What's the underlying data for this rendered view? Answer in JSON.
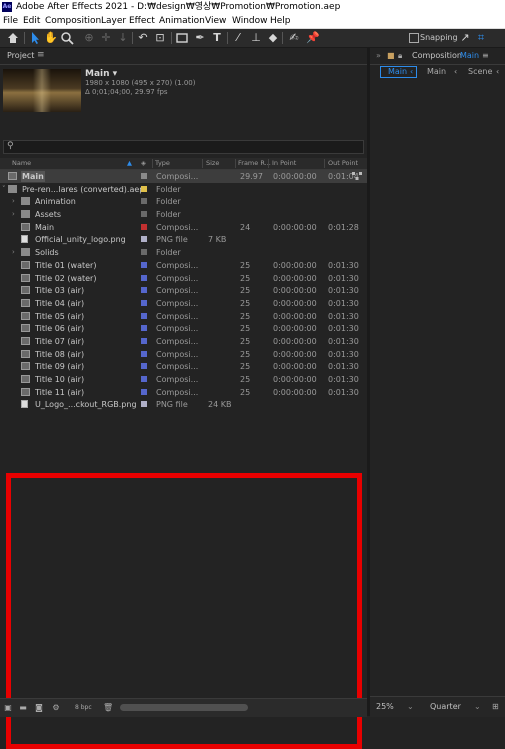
{
  "window": {
    "app_icon": "Ae",
    "title": "Adobe After Effects 2021 - D:₩design₩영상₩Promotion₩Promotion.aep"
  },
  "menu": [
    "File",
    "Edit",
    "Composition",
    "Layer",
    "Effect",
    "Animation",
    "View",
    "Window",
    "Help"
  ],
  "toolbar": {
    "snapping_label": "Snapping"
  },
  "project_panel": {
    "title": "Project",
    "menu_icon": "≡",
    "selected_comp": {
      "name": "Main ▾",
      "size_info": "1980 x 1080  (495 x 270) (1.00)",
      "duration_info": "Δ 0;01;04;00, 29.97 fps"
    },
    "search_placeholder": "",
    "columns": [
      "Name",
      "Type",
      "Size",
      "Frame R...",
      "In Point",
      "Out Point"
    ],
    "items": [
      {
        "name": "Main",
        "type": "Composi...",
        "size": "",
        "fps": "29.97",
        "in": "0:00:00:00",
        "out": "0:01:04",
        "icon": "comp",
        "label": "#8a8a8a",
        "indent": 0,
        "twirl": "",
        "bold": true
      },
      {
        "name": "Pre-ren...lares (converted).aep",
        "type": "Folder",
        "size": "",
        "fps": "",
        "in": "",
        "out": "",
        "icon": "folder",
        "label": "#e0c04a",
        "indent": 0,
        "twirl": "˅"
      },
      {
        "name": "Animation",
        "type": "Folder",
        "size": "",
        "fps": "",
        "in": "",
        "out": "",
        "icon": "folder",
        "label": "#6a6a6a",
        "indent": 1,
        "twirl": "›"
      },
      {
        "name": "Assets",
        "type": "Folder",
        "size": "",
        "fps": "",
        "in": "",
        "out": "",
        "icon": "folder",
        "label": "#6a6a6a",
        "indent": 1,
        "twirl": "›"
      },
      {
        "name": "Main",
        "type": "Composi...",
        "size": "",
        "fps": "24",
        "in": "0:00:00:00",
        "out": "0:01:28",
        "icon": "comp",
        "label": "#c23030",
        "indent": 1,
        "twirl": ""
      },
      {
        "name": "Official_unity_logo.png",
        "type": "PNG file",
        "size": "7 KB",
        "fps": "",
        "in": "",
        "out": "",
        "icon": "file",
        "label": "#b0b0c8",
        "indent": 1,
        "twirl": ""
      },
      {
        "name": "Solids",
        "type": "Folder",
        "size": "",
        "fps": "",
        "in": "",
        "out": "",
        "icon": "folder",
        "label": "#6a6a6a",
        "indent": 1,
        "twirl": "›"
      },
      {
        "name": "Title 01 (water)",
        "type": "Composi...",
        "size": "",
        "fps": "25",
        "in": "0:00:00:00",
        "out": "0:01:30",
        "icon": "comp",
        "label": "#5566cc",
        "indent": 1,
        "twirl": ""
      },
      {
        "name": "Title 02 (water)",
        "type": "Composi...",
        "size": "",
        "fps": "25",
        "in": "0:00:00:00",
        "out": "0:01:30",
        "icon": "comp",
        "label": "#5566cc",
        "indent": 1,
        "twirl": ""
      },
      {
        "name": "Title 03 (air)",
        "type": "Composi...",
        "size": "",
        "fps": "25",
        "in": "0:00:00:00",
        "out": "0:01:30",
        "icon": "comp",
        "label": "#5566cc",
        "indent": 1,
        "twirl": ""
      },
      {
        "name": "Title 04 (air)",
        "type": "Composi...",
        "size": "",
        "fps": "25",
        "in": "0:00:00:00",
        "out": "0:01:30",
        "icon": "comp",
        "label": "#5566cc",
        "indent": 1,
        "twirl": ""
      },
      {
        "name": "Title 05 (air)",
        "type": "Composi...",
        "size": "",
        "fps": "25",
        "in": "0:00:00:00",
        "out": "0:01:30",
        "icon": "comp",
        "label": "#5566cc",
        "indent": 1,
        "twirl": ""
      },
      {
        "name": "Title 06 (air)",
        "type": "Composi...",
        "size": "",
        "fps": "25",
        "in": "0:00:00:00",
        "out": "0:01:30",
        "icon": "comp",
        "label": "#5566cc",
        "indent": 1,
        "twirl": ""
      },
      {
        "name": "Title 07 (air)",
        "type": "Composi...",
        "size": "",
        "fps": "25",
        "in": "0:00:00:00",
        "out": "0:01:30",
        "icon": "comp",
        "label": "#5566cc",
        "indent": 1,
        "twirl": ""
      },
      {
        "name": "Title 08 (air)",
        "type": "Composi...",
        "size": "",
        "fps": "25",
        "in": "0:00:00:00",
        "out": "0:01:30",
        "icon": "comp",
        "label": "#5566cc",
        "indent": 1,
        "twirl": ""
      },
      {
        "name": "Title 09 (air)",
        "type": "Composi...",
        "size": "",
        "fps": "25",
        "in": "0:00:00:00",
        "out": "0:01:30",
        "icon": "comp",
        "label": "#5566cc",
        "indent": 1,
        "twirl": ""
      },
      {
        "name": "Title 10 (air)",
        "type": "Composi...",
        "size": "",
        "fps": "25",
        "in": "0:00:00:00",
        "out": "0:01:30",
        "icon": "comp",
        "label": "#5566cc",
        "indent": 1,
        "twirl": ""
      },
      {
        "name": "Title 11 (air)",
        "type": "Composi...",
        "size": "",
        "fps": "25",
        "in": "0:00:00:00",
        "out": "0:01:30",
        "icon": "comp",
        "label": "#5566cc",
        "indent": 1,
        "twirl": ""
      },
      {
        "name": "U_Logo_...ckout_RGB.png",
        "type": "PNG file",
        "size": "24 KB",
        "fps": "",
        "in": "",
        "out": "",
        "icon": "file",
        "label": "#b0b0c8",
        "indent": 1,
        "twirl": ""
      }
    ],
    "footer": {
      "bpc_label": "8 bpc"
    }
  },
  "comp_panel": {
    "title_prefix": "Composition",
    "title_name": "Main",
    "menu_icon": "≡",
    "tabs": [
      "Main",
      "Main",
      "Scene"
    ],
    "zoom": "25%",
    "resolution": "Quarter"
  },
  "colors": {
    "accent": "#2d8ceb",
    "highlight_box": "#e80000"
  }
}
